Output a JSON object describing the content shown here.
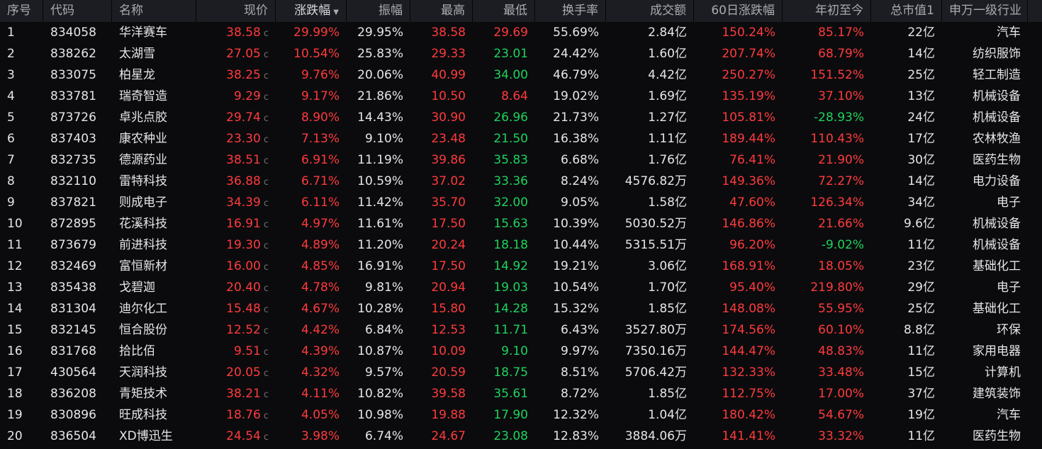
{
  "headers": [
    "序号",
    "代码",
    "名称",
    "现价",
    "涨跌幅",
    "振幅",
    "最高",
    "最低",
    "换手率",
    "成交额",
    "60日涨跌幅",
    "年初至今",
    "总市值1",
    "申万一级行业"
  ],
  "sort_indicator": "▼",
  "colors": {
    "up": "#ff3b3b",
    "down": "#1fd35b",
    "neutral": "#e6e6e6",
    "header_bg": "#1c1d22",
    "bg": "#0b0b0e"
  },
  "rows": [
    {
      "idx": "1",
      "code": "834058",
      "name": "华洋赛车",
      "price": "38.58",
      "tag": "c",
      "chg": "29.99%",
      "amp": "29.95%",
      "high": "38.58",
      "low": "29.69",
      "turnover": "55.69%",
      "volume": "2.84亿",
      "chg60": "150.24%",
      "ytd": "85.17%",
      "mktcap": "22亿",
      "industry": "汽车",
      "colors": {
        "price": "red",
        "chg": "red",
        "high": "red",
        "low": "red",
        "chg60": "red",
        "ytd": "red"
      }
    },
    {
      "idx": "2",
      "code": "838262",
      "name": "太湖雪",
      "price": "27.05",
      "tag": "c",
      "chg": "10.54%",
      "amp": "25.83%",
      "high": "29.33",
      "low": "23.01",
      "turnover": "24.42%",
      "volume": "1.60亿",
      "chg60": "207.74%",
      "ytd": "68.79%",
      "mktcap": "14亿",
      "industry": "纺织服饰",
      "colors": {
        "price": "red",
        "chg": "red",
        "high": "red",
        "low": "green",
        "chg60": "red",
        "ytd": "red"
      }
    },
    {
      "idx": "3",
      "code": "833075",
      "name": "柏星龙",
      "price": "38.25",
      "tag": "c",
      "chg": "9.76%",
      "amp": "20.06%",
      "high": "40.99",
      "low": "34.00",
      "turnover": "46.79%",
      "volume": "4.42亿",
      "chg60": "250.27%",
      "ytd": "151.52%",
      "mktcap": "25亿",
      "industry": "轻工制造",
      "colors": {
        "price": "red",
        "chg": "red",
        "high": "red",
        "low": "green",
        "chg60": "red",
        "ytd": "red"
      }
    },
    {
      "idx": "4",
      "code": "833781",
      "name": "瑞奇智造",
      "price": "9.29",
      "tag": "c",
      "chg": "9.17%",
      "amp": "21.86%",
      "high": "10.50",
      "low": "8.64",
      "turnover": "19.02%",
      "volume": "1.69亿",
      "chg60": "135.19%",
      "ytd": "37.10%",
      "mktcap": "13亿",
      "industry": "机械设备",
      "colors": {
        "price": "red",
        "chg": "red",
        "high": "red",
        "low": "red",
        "chg60": "red",
        "ytd": "red"
      }
    },
    {
      "idx": "5",
      "code": "873726",
      "name": "卓兆点胶",
      "price": "29.74",
      "tag": "c",
      "chg": "8.90%",
      "amp": "14.43%",
      "high": "30.90",
      "low": "26.96",
      "turnover": "21.73%",
      "volume": "1.27亿",
      "chg60": "105.81%",
      "ytd": "-28.93%",
      "mktcap": "24亿",
      "industry": "机械设备",
      "colors": {
        "price": "red",
        "chg": "red",
        "high": "red",
        "low": "green",
        "chg60": "red",
        "ytd": "green"
      }
    },
    {
      "idx": "6",
      "code": "837403",
      "name": "康农种业",
      "price": "23.30",
      "tag": "c",
      "chg": "7.13%",
      "amp": "9.10%",
      "high": "23.48",
      "low": "21.50",
      "turnover": "16.38%",
      "volume": "1.11亿",
      "chg60": "189.44%",
      "ytd": "110.43%",
      "mktcap": "17亿",
      "industry": "农林牧渔",
      "colors": {
        "price": "red",
        "chg": "red",
        "high": "red",
        "low": "green",
        "chg60": "red",
        "ytd": "red"
      }
    },
    {
      "idx": "7",
      "code": "832735",
      "name": "德源药业",
      "price": "38.51",
      "tag": "c",
      "chg": "6.91%",
      "amp": "11.19%",
      "high": "39.86",
      "low": "35.83",
      "turnover": "6.68%",
      "volume": "1.76亿",
      "chg60": "76.41%",
      "ytd": "21.90%",
      "mktcap": "30亿",
      "industry": "医药生物",
      "colors": {
        "price": "red",
        "chg": "red",
        "high": "red",
        "low": "green",
        "chg60": "red",
        "ytd": "red"
      }
    },
    {
      "idx": "8",
      "code": "832110",
      "name": "雷特科技",
      "price": "36.88",
      "tag": "c",
      "chg": "6.71%",
      "amp": "10.59%",
      "high": "37.02",
      "low": "33.36",
      "turnover": "8.24%",
      "volume": "4576.82万",
      "chg60": "149.36%",
      "ytd": "72.27%",
      "mktcap": "14亿",
      "industry": "电力设备",
      "colors": {
        "price": "red",
        "chg": "red",
        "high": "red",
        "low": "green",
        "chg60": "red",
        "ytd": "red"
      }
    },
    {
      "idx": "9",
      "code": "837821",
      "name": "则成电子",
      "price": "34.39",
      "tag": "c",
      "chg": "6.11%",
      "amp": "11.42%",
      "high": "35.70",
      "low": "32.00",
      "turnover": "9.05%",
      "volume": "1.58亿",
      "chg60": "47.60%",
      "ytd": "126.34%",
      "mktcap": "34亿",
      "industry": "电子",
      "colors": {
        "price": "red",
        "chg": "red",
        "high": "red",
        "low": "green",
        "chg60": "red",
        "ytd": "red"
      }
    },
    {
      "idx": "10",
      "code": "872895",
      "name": "花溪科技",
      "price": "16.91",
      "tag": "c",
      "chg": "4.97%",
      "amp": "11.61%",
      "high": "17.50",
      "low": "15.63",
      "turnover": "10.39%",
      "volume": "5030.52万",
      "chg60": "146.86%",
      "ytd": "21.66%",
      "mktcap": "9.6亿",
      "industry": "机械设备",
      "colors": {
        "price": "red",
        "chg": "red",
        "high": "red",
        "low": "green",
        "chg60": "red",
        "ytd": "red"
      }
    },
    {
      "idx": "11",
      "code": "873679",
      "name": "前进科技",
      "price": "19.30",
      "tag": "c",
      "chg": "4.89%",
      "amp": "11.20%",
      "high": "20.24",
      "low": "18.18",
      "turnover": "10.44%",
      "volume": "5315.51万",
      "chg60": "96.20%",
      "ytd": "-9.02%",
      "mktcap": "11亿",
      "industry": "机械设备",
      "colors": {
        "price": "red",
        "chg": "red",
        "high": "red",
        "low": "green",
        "chg60": "red",
        "ytd": "green"
      }
    },
    {
      "idx": "12",
      "code": "832469",
      "name": "富恒新材",
      "price": "16.00",
      "tag": "c",
      "chg": "4.85%",
      "amp": "16.91%",
      "high": "17.50",
      "low": "14.92",
      "turnover": "19.21%",
      "volume": "3.06亿",
      "chg60": "168.91%",
      "ytd": "18.05%",
      "mktcap": "23亿",
      "industry": "基础化工",
      "colors": {
        "price": "red",
        "chg": "red",
        "high": "red",
        "low": "green",
        "chg60": "red",
        "ytd": "red"
      }
    },
    {
      "idx": "13",
      "code": "835438",
      "name": "戈碧迦",
      "price": "20.40",
      "tag": "c",
      "chg": "4.78%",
      "amp": "9.81%",
      "high": "20.94",
      "low": "19.03",
      "turnover": "10.54%",
      "volume": "1.70亿",
      "chg60": "95.40%",
      "ytd": "219.80%",
      "mktcap": "29亿",
      "industry": "电子",
      "colors": {
        "price": "red",
        "chg": "red",
        "high": "red",
        "low": "green",
        "chg60": "red",
        "ytd": "red"
      }
    },
    {
      "idx": "14",
      "code": "831304",
      "name": "迪尔化工",
      "price": "15.48",
      "tag": "c",
      "chg": "4.67%",
      "amp": "10.28%",
      "high": "15.80",
      "low": "14.28",
      "turnover": "15.32%",
      "volume": "1.85亿",
      "chg60": "148.08%",
      "ytd": "55.95%",
      "mktcap": "25亿",
      "industry": "基础化工",
      "colors": {
        "price": "red",
        "chg": "red",
        "high": "red",
        "low": "green",
        "chg60": "red",
        "ytd": "red"
      }
    },
    {
      "idx": "15",
      "code": "832145",
      "name": "恒合股份",
      "price": "12.52",
      "tag": "c",
      "chg": "4.42%",
      "amp": "6.84%",
      "high": "12.53",
      "low": "11.71",
      "turnover": "6.43%",
      "volume": "3527.80万",
      "chg60": "174.56%",
      "ytd": "60.10%",
      "mktcap": "8.8亿",
      "industry": "环保",
      "colors": {
        "price": "red",
        "chg": "red",
        "high": "red",
        "low": "green",
        "chg60": "red",
        "ytd": "red"
      }
    },
    {
      "idx": "16",
      "code": "831768",
      "name": "拾比佰",
      "price": "9.51",
      "tag": "c",
      "chg": "4.39%",
      "amp": "10.87%",
      "high": "10.09",
      "low": "9.10",
      "turnover": "9.97%",
      "volume": "7350.16万",
      "chg60": "144.47%",
      "ytd": "48.83%",
      "mktcap": "11亿",
      "industry": "家用电器",
      "colors": {
        "price": "red",
        "chg": "red",
        "high": "red",
        "low": "green",
        "chg60": "red",
        "ytd": "red"
      }
    },
    {
      "idx": "17",
      "code": "430564",
      "name": "天润科技",
      "price": "20.05",
      "tag": "c",
      "chg": "4.32%",
      "amp": "9.57%",
      "high": "20.59",
      "low": "18.75",
      "turnover": "8.51%",
      "volume": "5706.42万",
      "chg60": "132.33%",
      "ytd": "33.48%",
      "mktcap": "15亿",
      "industry": "计算机",
      "colors": {
        "price": "red",
        "chg": "red",
        "high": "red",
        "low": "green",
        "chg60": "red",
        "ytd": "red"
      }
    },
    {
      "idx": "18",
      "code": "836208",
      "name": "青矩技术",
      "price": "38.21",
      "tag": "c",
      "chg": "4.11%",
      "amp": "10.82%",
      "high": "39.58",
      "low": "35.61",
      "turnover": "8.72%",
      "volume": "1.85亿",
      "chg60": "112.75%",
      "ytd": "17.00%",
      "mktcap": "37亿",
      "industry": "建筑装饰",
      "colors": {
        "price": "red",
        "chg": "red",
        "high": "red",
        "low": "green",
        "chg60": "red",
        "ytd": "red"
      }
    },
    {
      "idx": "19",
      "code": "830896",
      "name": "旺成科技",
      "price": "18.76",
      "tag": "c",
      "chg": "4.05%",
      "amp": "10.98%",
      "high": "19.88",
      "low": "17.90",
      "turnover": "12.32%",
      "volume": "1.04亿",
      "chg60": "180.42%",
      "ytd": "54.67%",
      "mktcap": "19亿",
      "industry": "汽车",
      "colors": {
        "price": "red",
        "chg": "red",
        "high": "red",
        "low": "green",
        "chg60": "red",
        "ytd": "red"
      }
    },
    {
      "idx": "20",
      "code": "836504",
      "name": "XD博迅生",
      "price": "24.54",
      "tag": "c",
      "chg": "3.98%",
      "amp": "6.74%",
      "high": "24.67",
      "low": "23.08",
      "turnover": "12.83%",
      "volume": "3884.06万",
      "chg60": "141.41%",
      "ytd": "33.32%",
      "mktcap": "11亿",
      "industry": "医药生物",
      "colors": {
        "price": "red",
        "chg": "red",
        "high": "red",
        "low": "green",
        "chg60": "red",
        "ytd": "red"
      }
    }
  ]
}
